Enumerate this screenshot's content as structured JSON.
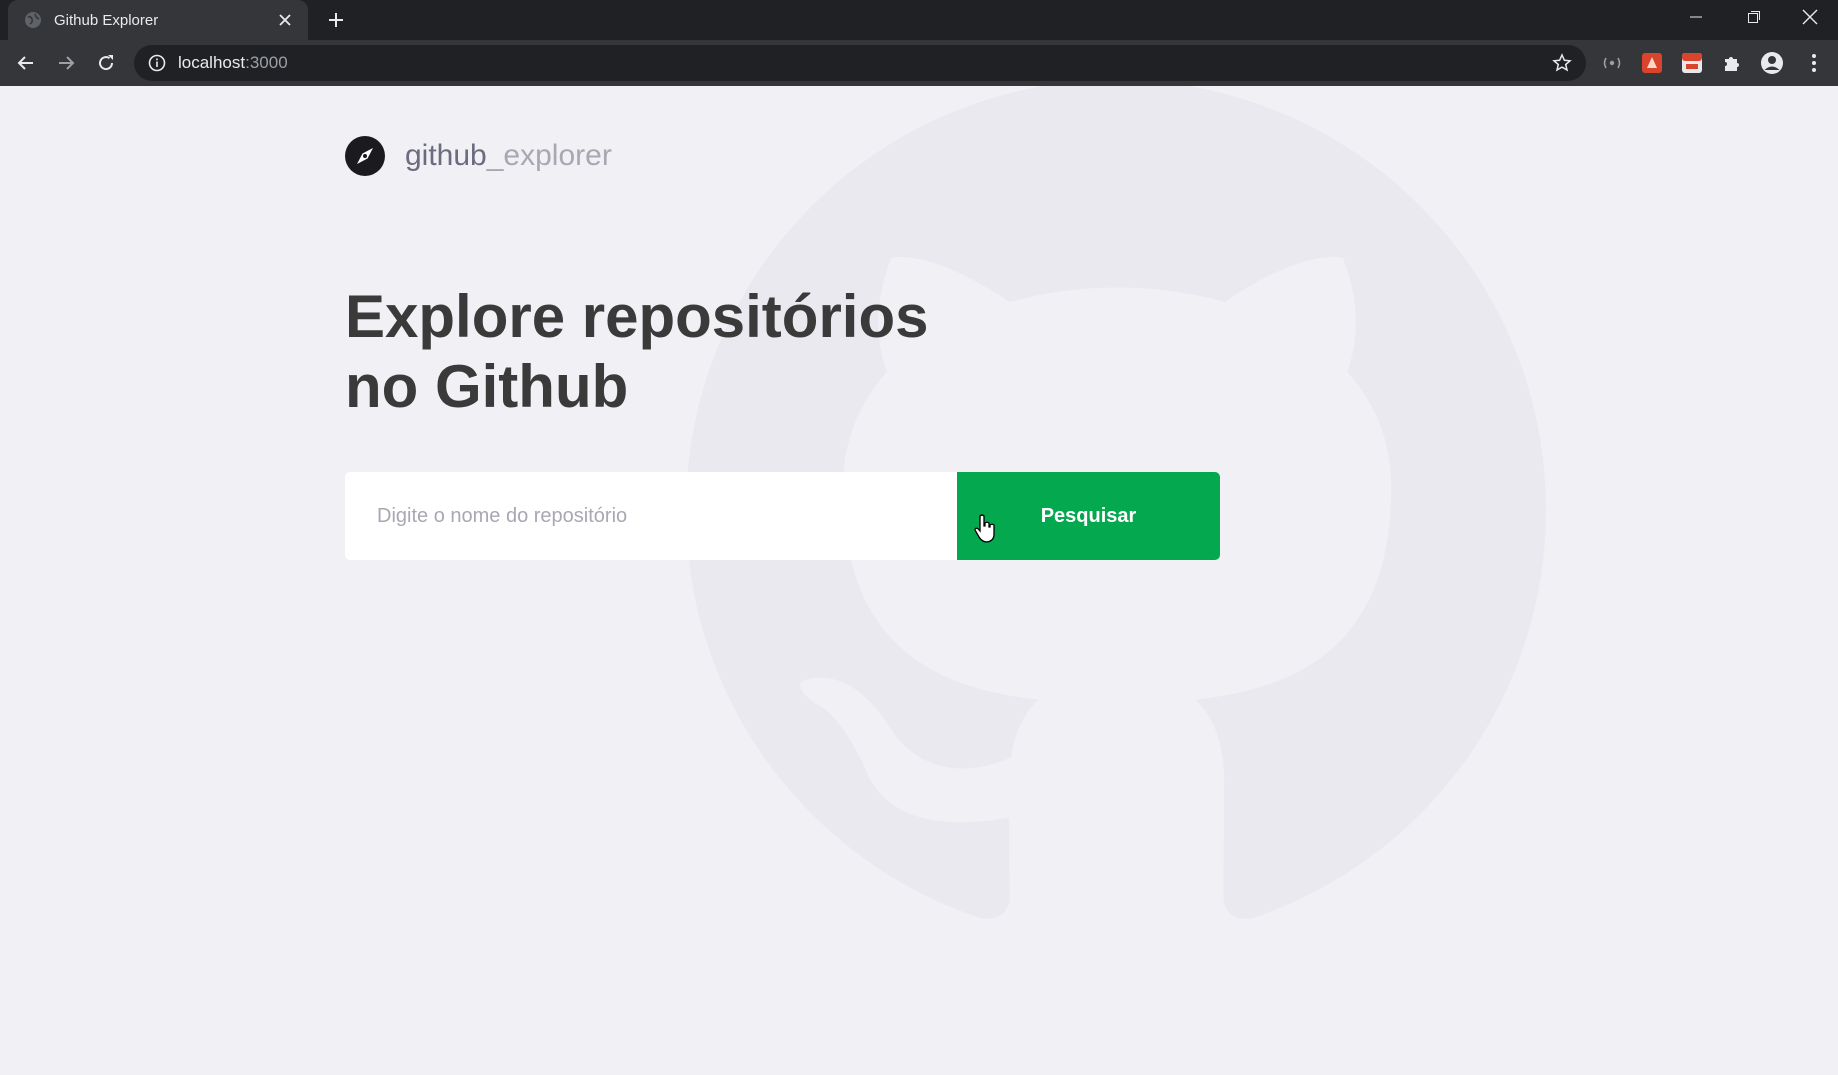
{
  "browser": {
    "tab_title": "Github Explorer",
    "url_host": "localhost",
    "url_port": ":3000"
  },
  "icons": {
    "favicon": "globe-icon",
    "tab_close": "close-icon",
    "new_tab": "plus-icon",
    "back": "arrow-left-icon",
    "forward": "arrow-right-icon",
    "reload": "reload-icon",
    "site_info": "info-icon",
    "bookmark": "star-icon",
    "extensions": "puzzle-icon",
    "profile": "account-icon",
    "menu": "more-vert-icon",
    "logo": "compass-icon",
    "background": "octocat-icon",
    "cursor": "hand-pointer-icon"
  },
  "header": {
    "brand_primary": "github",
    "brand_secondary": "_explorer"
  },
  "main": {
    "title_line1": "Explore repositórios",
    "title_line2": "no Github",
    "search": {
      "placeholder": "Digite o nome do repositório",
      "value": "",
      "button_label": "Pesquisar"
    }
  },
  "colors": {
    "page_background": "#f0f0f5",
    "title_text": "#3a3a3a",
    "brand_primary": "#6c6c80",
    "brand_secondary": "#a8a8b3",
    "button_accent": "#04a94f",
    "chrome_dark": "#202124",
    "chrome_toolbar": "#35363a"
  }
}
